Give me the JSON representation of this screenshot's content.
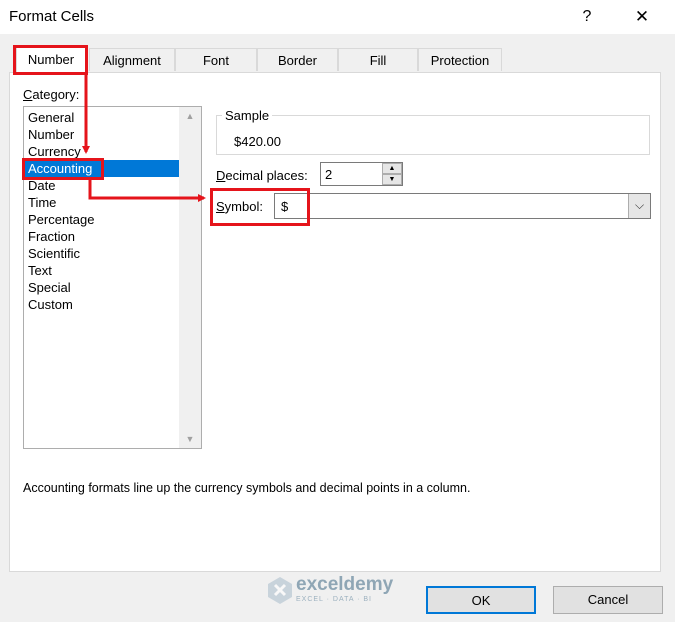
{
  "window": {
    "title": "Format Cells",
    "help": "?",
    "close": "✕"
  },
  "tabs": [
    {
      "label": "Number",
      "active": true
    },
    {
      "label": "Alignment",
      "active": false
    },
    {
      "label": "Font",
      "active": false
    },
    {
      "label": "Border",
      "active": false
    },
    {
      "label": "Fill",
      "active": false
    },
    {
      "label": "Protection",
      "active": false
    }
  ],
  "category": {
    "label_key": "C",
    "label_rest": "ategory:",
    "items": [
      "General",
      "Number",
      "Currency",
      "Accounting",
      "Date",
      "Time",
      "Percentage",
      "Fraction",
      "Scientific",
      "Text",
      "Special",
      "Custom"
    ],
    "selected": "Accounting"
  },
  "sample": {
    "legend": "Sample",
    "value": "$420.00"
  },
  "decimal": {
    "label_key": "D",
    "label_rest": "ecimal places:",
    "value": "2"
  },
  "symbol": {
    "label_key": "S",
    "label_rest": "ymbol:",
    "value": "$"
  },
  "description": "Accounting formats line up the currency symbols and decimal points in a column.",
  "buttons": {
    "ok": "OK",
    "cancel": "Cancel"
  },
  "watermark": {
    "name": "exceldemy",
    "tagline": "EXCEL · DATA · BI"
  },
  "annotation_color": "#e5141b",
  "accent_color": "#0078d7"
}
